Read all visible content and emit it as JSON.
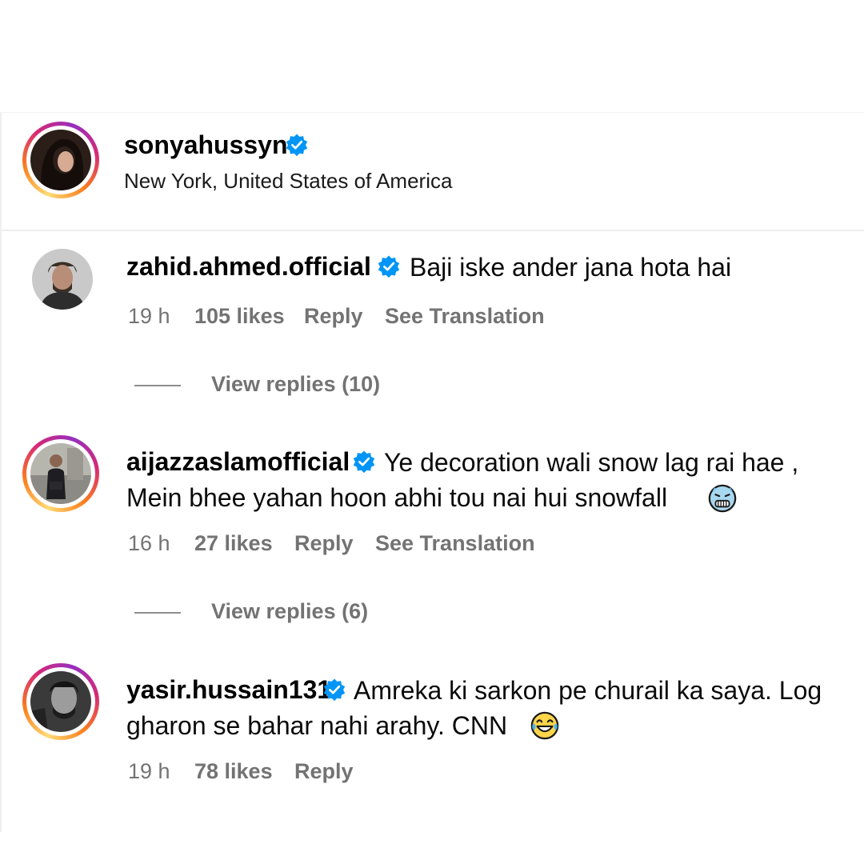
{
  "post": {
    "username": "sonyahussyn",
    "location": "New York, United States of America"
  },
  "comments": [
    {
      "username": "zahid.ahmed.official",
      "text_lines": [
        "Baji iske ander jana hota hai"
      ],
      "time": "19 h",
      "likes": "105 likes",
      "reply": "Reply",
      "translate": "See Translation",
      "view_replies": "View replies (10)"
    },
    {
      "username": "aijazzaslamofficial",
      "text_lines": [
        "Ye decoration wali snow lag rai hae ,",
        "Mein bhee yahan hoon abhi tou nai hui snowfall"
      ],
      "emoji": "cold-face-emoji",
      "time": "16 h",
      "likes": "27 likes",
      "reply": "Reply",
      "translate": "See Translation",
      "view_replies": "View replies (6)"
    },
    {
      "username": "yasir.hussain131",
      "text_lines": [
        "Amreka ki sarkon pe churail ka saya. Log",
        "gharon se bahar nahi arahy. CNN"
      ],
      "emoji": "tears-of-joy-emoji",
      "time": "19 h",
      "likes": "78 likes",
      "reply": "Reply"
    }
  ],
  "colors": {
    "verified": "#0095f6",
    "secondary_text": "#737373"
  }
}
